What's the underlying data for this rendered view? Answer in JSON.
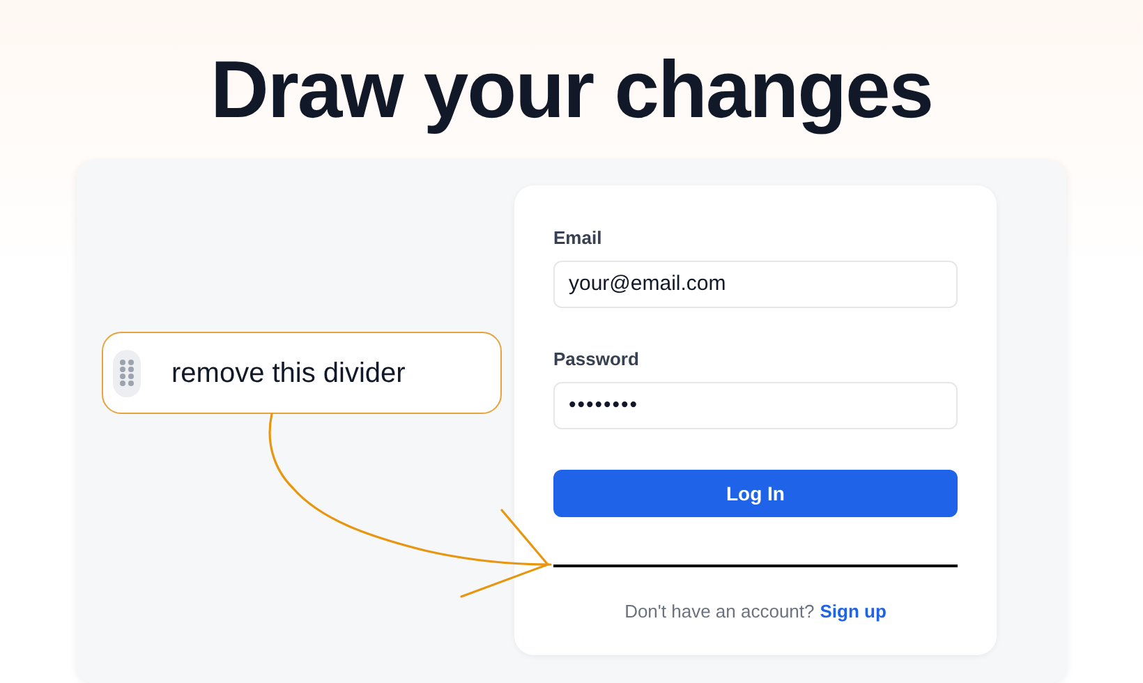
{
  "heading": "Draw your changes",
  "comment": {
    "text": "remove this divider"
  },
  "login_form": {
    "email": {
      "label": "Email",
      "value": "your@email.com"
    },
    "password": {
      "label": "Password",
      "value": "••••••••"
    },
    "submit_button": "Log In",
    "signup_prompt": {
      "text": "Don't have an account?",
      "link": "Sign up"
    }
  }
}
